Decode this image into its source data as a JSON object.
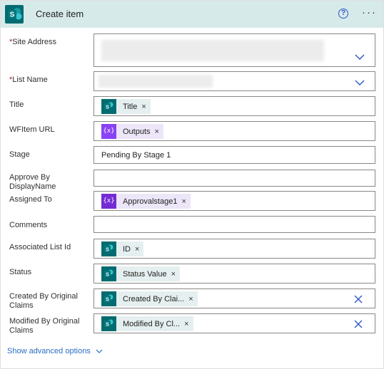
{
  "header": {
    "title": "Create item",
    "help_label": "?",
    "more_label": "···"
  },
  "fields": {
    "site_address": {
      "label": "Site Address",
      "required": "*"
    },
    "list_name": {
      "label": "List Name",
      "required": "*"
    },
    "title": {
      "label": "Title",
      "token": "Title"
    },
    "wfitem_url": {
      "label": "WFItem URL",
      "token": "Outputs"
    },
    "stage": {
      "label": "Stage",
      "value": "Pending By Stage 1"
    },
    "approve_by": {
      "label": "Approve By DisplayName",
      "value": ""
    },
    "assigned_to": {
      "label": "Assigned To",
      "token": "Approvalstage1"
    },
    "comments": {
      "label": "Comments",
      "value": ""
    },
    "associated_list_id": {
      "label": "Associated List Id",
      "token": "ID"
    },
    "status": {
      "label": "Status",
      "token": "Status Value"
    },
    "created_by": {
      "label": "Created By Original Claims",
      "token": "Created By Clai..."
    },
    "modified_by": {
      "label": "Modified By Original Claims",
      "token": "Modified By Cl..."
    }
  },
  "token_remove_glyph": "×",
  "variable_icon_glyph": "{x}",
  "advanced": {
    "label": "Show advanced options"
  },
  "colors": {
    "header_bg": "#d7eaea",
    "sharepoint": "#036c70",
    "variable": "#8a42f5",
    "link": "#2b6cc4",
    "required": "#a4262c"
  }
}
